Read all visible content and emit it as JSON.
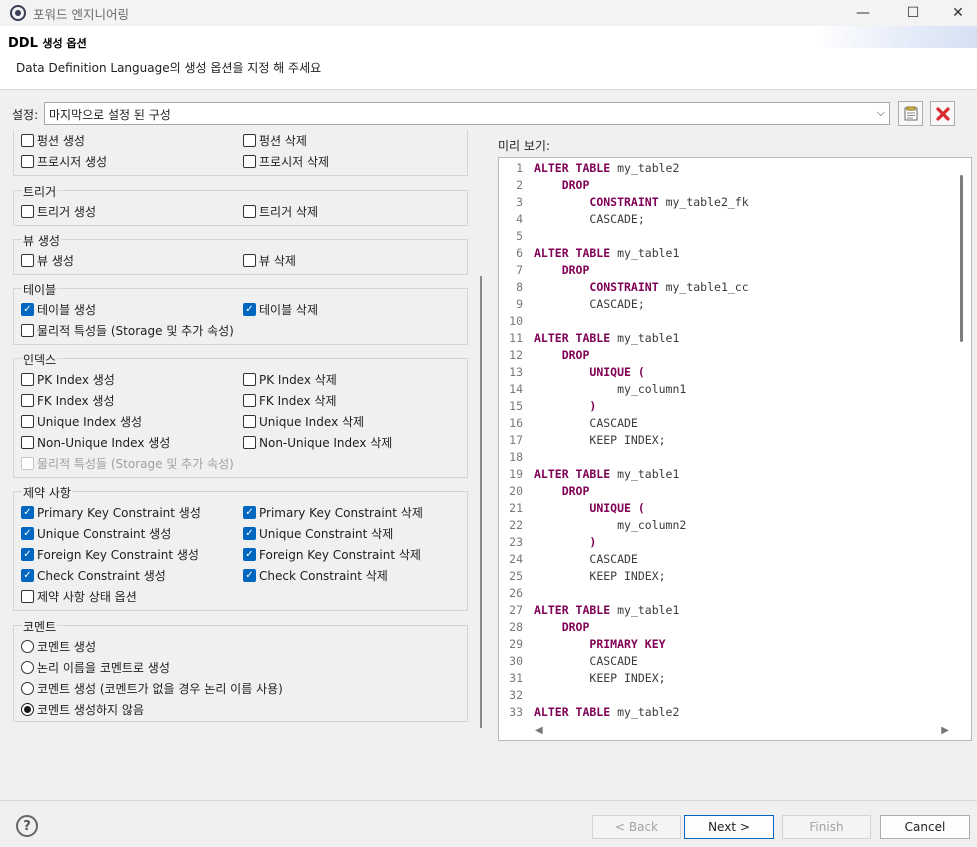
{
  "window": {
    "title": "포워드 엔지니어링",
    "controls": {
      "minimize": "—",
      "maximize": "☐",
      "close": "✕"
    }
  },
  "header": {
    "title": "DDL",
    "title_suffix": "생성 옵션",
    "description": "Data Definition Language의 생성 옵션을 지정 해 주세요"
  },
  "settings": {
    "label": "설정:",
    "value": "마지막으로 설정 된 구성",
    "icons": [
      "save-config-icon",
      "delete-config-icon"
    ]
  },
  "options": {
    "function_group": {
      "items": [
        {
          "label": "펑션 생성",
          "checked": false
        },
        {
          "label": "펑션 삭제",
          "checked": false
        },
        {
          "label": "프로시저 생성",
          "checked": false
        },
        {
          "label": "프로시저 삭제",
          "checked": false
        }
      ]
    },
    "trigger_group": {
      "title": "트리거",
      "items": [
        {
          "label": "트리거 생성",
          "checked": false
        },
        {
          "label": "트리거 삭제",
          "checked": false
        }
      ]
    },
    "view_group": {
      "title": "뷰 생성",
      "items": [
        {
          "label": "뷰 생성",
          "checked": false
        },
        {
          "label": "뷰 삭제",
          "checked": false
        }
      ]
    },
    "table_group": {
      "title": "테이블",
      "items": [
        {
          "label": "테이블 생성",
          "checked": true
        },
        {
          "label": "테이블 삭제",
          "checked": true
        },
        {
          "label": "물리적 특성들 (Storage 및 추가 속성)",
          "checked": false
        }
      ]
    },
    "index_group": {
      "title": "인덱스",
      "items": [
        {
          "label": "PK Index 생성",
          "checked": false
        },
        {
          "label": "PK Index 삭제",
          "checked": false
        },
        {
          "label": "FK Index 생성",
          "checked": false
        },
        {
          "label": "FK Index 삭제",
          "checked": false
        },
        {
          "label": "Unique Index 생성",
          "checked": false
        },
        {
          "label": "Unique Index 삭제",
          "checked": false
        },
        {
          "label": "Non-Unique Index 생성",
          "checked": false
        },
        {
          "label": "Non-Unique Index 삭제",
          "checked": false
        },
        {
          "label": "물리적 특성들 (Storage 및 추가 속성)",
          "checked": false,
          "disabled": true
        }
      ]
    },
    "constraint_group": {
      "title": "제약 사항",
      "items": [
        {
          "label": "Primary Key Constraint 생성",
          "checked": true
        },
        {
          "label": "Primary Key Constraint 삭제",
          "checked": true
        },
        {
          "label": "Unique Constraint 생성",
          "checked": true
        },
        {
          "label": "Unique Constraint 삭제",
          "checked": true
        },
        {
          "label": "Foreign Key Constraint 생성",
          "checked": true
        },
        {
          "label": "Foreign Key Constraint 삭제",
          "checked": true
        },
        {
          "label": "Check Constraint 생성",
          "checked": true
        },
        {
          "label": "Check Constraint 삭제",
          "checked": true
        },
        {
          "label": "제약 사항 상태 옵션",
          "checked": false
        }
      ]
    },
    "comment_group": {
      "title": "코멘트",
      "items": [
        {
          "label": "코멘트 생성",
          "selected": false
        },
        {
          "label": "논리 이름을 코멘트로 생성",
          "selected": false
        },
        {
          "label": "코멘트 생성 (코멘트가 없을 경우 논리 이름 사용)",
          "selected": false
        },
        {
          "label": "코멘트 생성하지 않음",
          "selected": true
        }
      ]
    }
  },
  "preview": {
    "label": "미리 보기:",
    "lines": [
      {
        "n": "1",
        "kw": "ALTER TABLE",
        "rest": " my_table2",
        "indent": ""
      },
      {
        "n": "2",
        "kw": "DROP",
        "rest": "",
        "indent": "    "
      },
      {
        "n": "3",
        "kw": "CONSTRAINT",
        "rest": " my_table2_fk",
        "indent": "        "
      },
      {
        "n": "4",
        "kw": "",
        "rest": "CASCADE;",
        "indent": "        "
      },
      {
        "n": "5",
        "kw": "",
        "rest": "",
        "indent": ""
      },
      {
        "n": "6",
        "kw": "ALTER TABLE",
        "rest": " my_table1",
        "indent": ""
      },
      {
        "n": "7",
        "kw": "DROP",
        "rest": "",
        "indent": "    "
      },
      {
        "n": "8",
        "kw": "CONSTRAINT",
        "rest": " my_table1_cc",
        "indent": "        "
      },
      {
        "n": "9",
        "kw": "",
        "rest": "CASCADE;",
        "indent": "        "
      },
      {
        "n": "10",
        "kw": "",
        "rest": "",
        "indent": ""
      },
      {
        "n": "11",
        "kw": "ALTER TABLE",
        "rest": " my_table1",
        "indent": ""
      },
      {
        "n": "12",
        "kw": "DROP",
        "rest": "",
        "indent": "    "
      },
      {
        "n": "13",
        "kw": "UNIQUE (",
        "rest": "",
        "indent": "        "
      },
      {
        "n": "14",
        "kw": "",
        "rest": "my_column1",
        "indent": "            "
      },
      {
        "n": "15",
        "kw": ")",
        "rest": "",
        "indent": "        "
      },
      {
        "n": "16",
        "kw": "",
        "rest": "CASCADE",
        "indent": "        "
      },
      {
        "n": "17",
        "kw": "",
        "rest": "KEEP INDEX;",
        "indent": "        "
      },
      {
        "n": "18",
        "kw": "",
        "rest": "",
        "indent": ""
      },
      {
        "n": "19",
        "kw": "ALTER TABLE",
        "rest": " my_table1",
        "indent": ""
      },
      {
        "n": "20",
        "kw": "DROP",
        "rest": "",
        "indent": "    "
      },
      {
        "n": "21",
        "kw": "UNIQUE (",
        "rest": "",
        "indent": "        "
      },
      {
        "n": "22",
        "kw": "",
        "rest": "my_column2",
        "indent": "            "
      },
      {
        "n": "23",
        "kw": ")",
        "rest": "",
        "indent": "        "
      },
      {
        "n": "24",
        "kw": "",
        "rest": "CASCADE",
        "indent": "        "
      },
      {
        "n": "25",
        "kw": "",
        "rest": "KEEP INDEX;",
        "indent": "        "
      },
      {
        "n": "26",
        "kw": "",
        "rest": "",
        "indent": ""
      },
      {
        "n": "27",
        "kw": "ALTER TABLE",
        "rest": " my_table1",
        "indent": ""
      },
      {
        "n": "28",
        "kw": "DROP",
        "rest": "",
        "indent": "    "
      },
      {
        "n": "29",
        "kw": "PRIMARY KEY",
        "rest": "",
        "indent": "        "
      },
      {
        "n": "30",
        "kw": "",
        "rest": "CASCADE",
        "indent": "        "
      },
      {
        "n": "31",
        "kw": "",
        "rest": "KEEP INDEX;",
        "indent": "        "
      },
      {
        "n": "32",
        "kw": "",
        "rest": "",
        "indent": ""
      },
      {
        "n": "33",
        "kw": "ALTER TABLE",
        "rest": " my_table2",
        "indent": ""
      }
    ]
  },
  "footer": {
    "help": "?",
    "back": "< Back",
    "next": "Next >",
    "finish": "Finish",
    "cancel": "Cancel"
  },
  "colors": {
    "keyword": "#7f0055",
    "checked": "#0067c0",
    "delete_icon": "#d92b2b"
  }
}
